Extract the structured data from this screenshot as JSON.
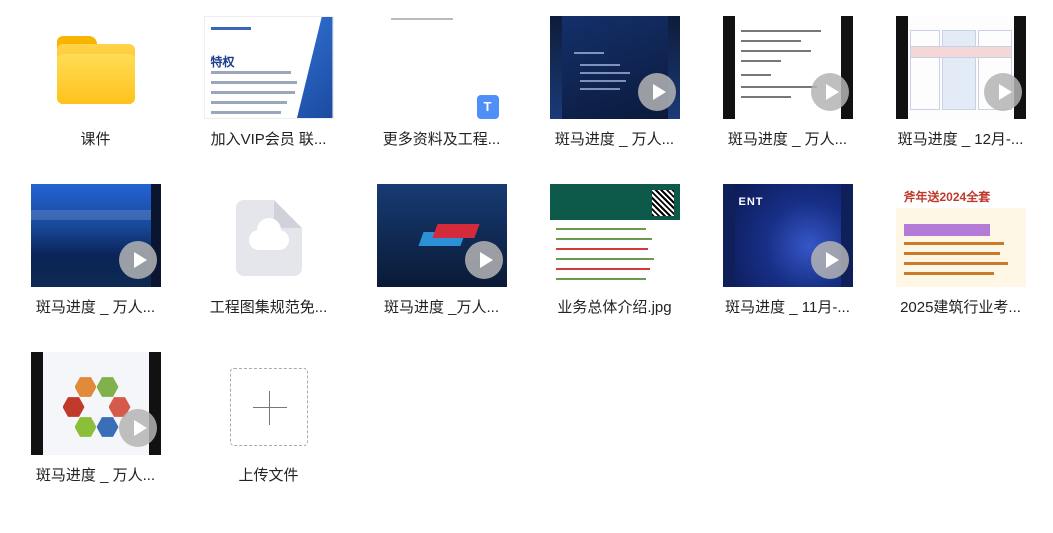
{
  "files": [
    {
      "id": "folder-kejian",
      "label": "课件",
      "type": "folder"
    },
    {
      "id": "vip",
      "label": "加入VIP会员 联...",
      "type": "image"
    },
    {
      "id": "more-docs",
      "label": "更多资料及工程...",
      "type": "doc",
      "badge": "T"
    },
    {
      "id": "zhanma-1",
      "label": "斑马进度 _ 万人...",
      "type": "video"
    },
    {
      "id": "zhanma-2",
      "label": "斑马进度 _ 万人...",
      "type": "video"
    },
    {
      "id": "zhanma-12",
      "label": "斑马进度 _ 12月-...",
      "type": "video"
    },
    {
      "id": "zhanma-3",
      "label": "斑马进度 _ 万人...",
      "type": "video"
    },
    {
      "id": "drawing-atlas",
      "label": "工程图集规范免...",
      "type": "cloud-file"
    },
    {
      "id": "zhanma-4",
      "label": "斑马进度 _万人...",
      "type": "video"
    },
    {
      "id": "business",
      "label": "业务总体介绍.jpg",
      "type": "image"
    },
    {
      "id": "zhanma-11",
      "label": "斑马进度 _ 11月-...",
      "type": "video"
    },
    {
      "id": "exam-2025",
      "label": "2025建筑行业考...",
      "type": "image"
    },
    {
      "id": "zhanma-5",
      "label": "斑马进度 _ 万人...",
      "type": "video"
    },
    {
      "id": "upload",
      "label": "上传文件",
      "type": "upload"
    }
  ],
  "thumb_text": {
    "vip_title": "特权",
    "ent_word": "ENT",
    "exam_head": "斧年送2024全套",
    "doc_badge": "T"
  },
  "colors": {
    "folder": "#ffc21d",
    "accent_blue": "#4f8ff7",
    "label_text": "#222222"
  }
}
